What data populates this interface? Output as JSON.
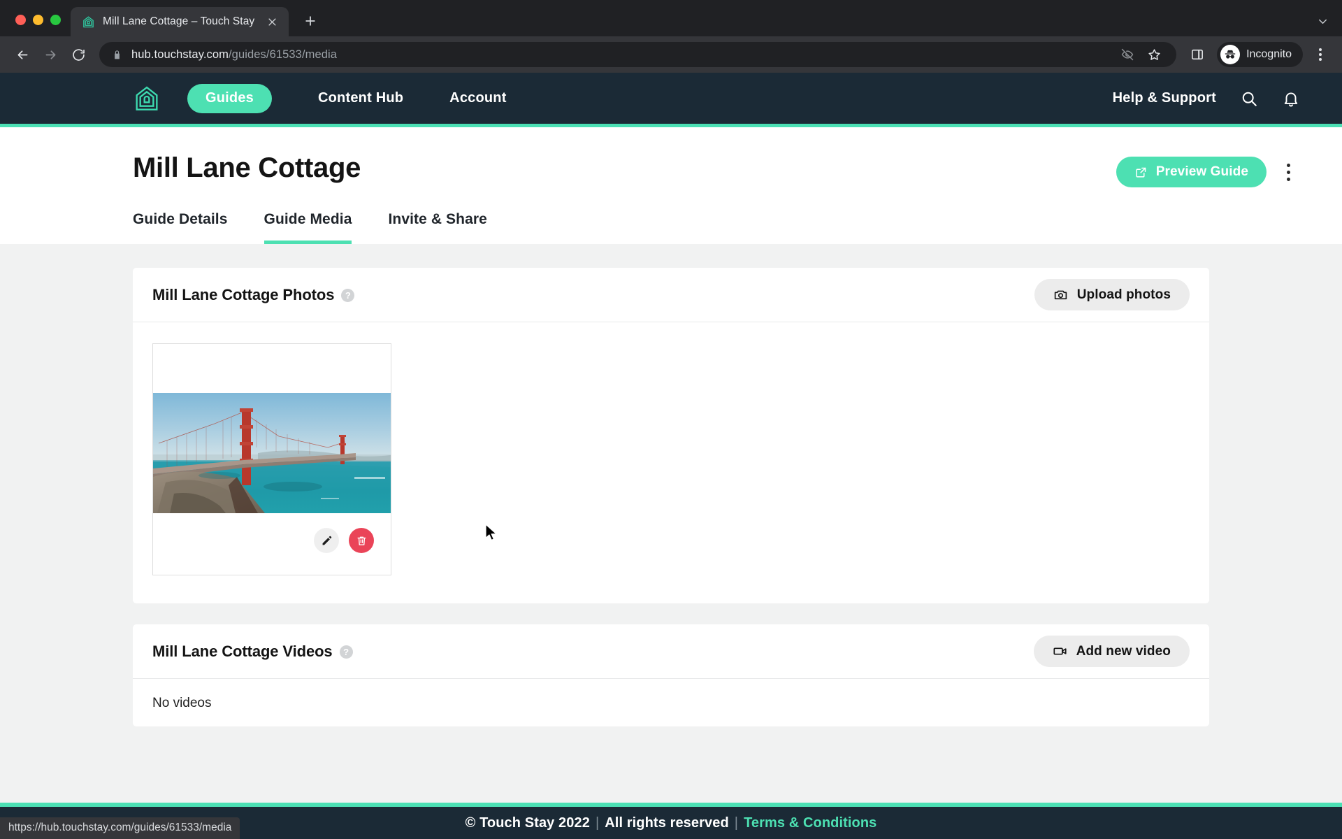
{
  "browser": {
    "tab": {
      "title": "Mill Lane Cottage – Touch Stay",
      "favicon_icon": "house-logo-icon",
      "close_icon": "close-icon"
    },
    "new_tab_icon": "plus-icon",
    "tab_list_icon": "chevron-down-icon",
    "nav": {
      "back_icon": "arrow-left-icon",
      "forward_icon": "arrow-right-icon",
      "reload_icon": "reload-icon"
    },
    "omnibox": {
      "lock_icon": "lock-icon",
      "url_host": "hub.touchstay.com",
      "url_path": "/guides/61533/media",
      "tracking_icon": "eye-off-icon",
      "bookmark_icon": "star-icon",
      "sidepanel_icon": "side-panel-icon"
    },
    "profile": {
      "label": "Incognito",
      "icon": "incognito-icon"
    },
    "menu_icon": "kebab-menu-icon",
    "status_url": "https://hub.touchstay.com/guides/61533/media"
  },
  "appnav": {
    "logo_icon": "touchstay-house-logo-icon",
    "items": [
      {
        "label": "Guides",
        "active": true
      },
      {
        "label": "Content Hub",
        "active": false
      },
      {
        "label": "Account",
        "active": false
      }
    ],
    "help_label": "Help & Support",
    "search_icon": "search-icon",
    "notifications_icon": "bell-icon"
  },
  "header": {
    "title": "Mill Lane Cottage",
    "preview_button": {
      "label": "Preview Guide",
      "icon": "external-link-icon"
    },
    "more_menu_icon": "kebab-menu-icon"
  },
  "tabs": [
    {
      "label": "Guide Details",
      "active": false
    },
    {
      "label": "Guide Media",
      "active": true
    },
    {
      "label": "Invite & Share",
      "active": false
    }
  ],
  "photos_card": {
    "title": "Mill Lane Cottage Photos",
    "help_icon": "question-mark-icon",
    "help_glyph": "?",
    "upload_button": {
      "label": "Upload photos",
      "icon": "camera-icon"
    },
    "items": [
      {
        "alt": "Golden Gate Bridge photograph",
        "edit_button": {
          "icon": "pencil-icon",
          "title": "Edit"
        },
        "delete_button": {
          "icon": "trash-icon",
          "title": "Delete"
        }
      }
    ]
  },
  "videos_card": {
    "title": "Mill Lane Cottage Videos",
    "help_icon": "question-mark-icon",
    "help_glyph": "?",
    "add_button": {
      "label": "Add new video",
      "icon": "video-camera-icon"
    },
    "empty_text": "No videos"
  },
  "footer": {
    "copyright": "© Touch Stay 2022",
    "separator": "|",
    "rights": "All rights reserved",
    "terms_link": "Terms & Conditions"
  },
  "colors": {
    "accent_teal": "#4de0b2",
    "nav_dark": "#1b2a36",
    "danger_red": "#ea4458",
    "page_bg": "#f1f2f2"
  }
}
